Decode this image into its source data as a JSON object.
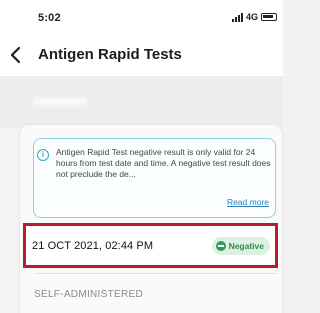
{
  "status_bar": {
    "time": "5:02",
    "network": "4G"
  },
  "header": {
    "title": "Antigen Rapid Tests"
  },
  "info": {
    "text": "Antigen Rapid Test negative result is only valid for 24 hours from test date and time. A negative test result does not preclude the de...",
    "read_more": "Read more"
  },
  "result": {
    "datetime": "21 OCT 2021, 02:44 PM",
    "status": "Negative",
    "status_color": "#2f9c55",
    "highlight_color": "#b51d2e"
  },
  "administration": {
    "label": "SELF-ADMINISTERED"
  }
}
